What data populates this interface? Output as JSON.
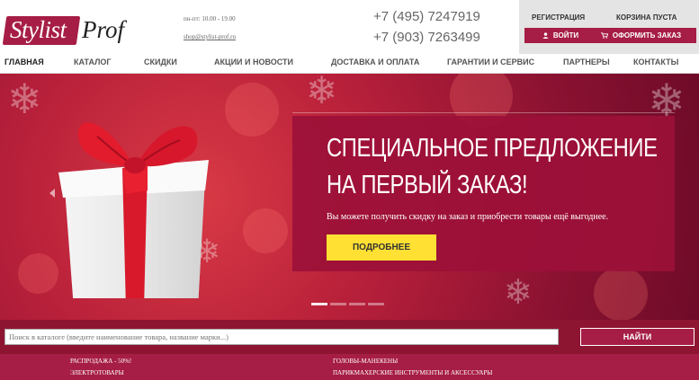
{
  "header": {
    "logo_part1": "Stylist",
    "logo_part2": "Prof",
    "hours": "пн-пт: 10.00 - 19.00",
    "email": "shop@stylist-prof.ru",
    "phone1": "+7 (495) 7247919",
    "phone2": "+7 (903) 7263499"
  },
  "account": {
    "register_label": "РЕГИСТРАЦИЯ",
    "cart_label": "КОРЗИНА ПУСТА",
    "login_button": "ВОЙТИ",
    "order_button": "ОФОРМИТЬ ЗАКАЗ"
  },
  "nav": {
    "items": [
      {
        "label": "Главная"
      },
      {
        "label": "Каталог"
      },
      {
        "label": "Скидки"
      },
      {
        "label": "Акции и новости"
      },
      {
        "label": "Доставка и оплата"
      },
      {
        "label": "Гарантии и сервис"
      },
      {
        "label": "Партнеры"
      },
      {
        "label": "Контакты"
      }
    ]
  },
  "banner": {
    "title_line1": "СПЕЦИАЛЬНОЕ ПРЕДЛОЖЕНИЕ",
    "title_line2": "НА ПЕРВЫЙ ЗАКАЗ!",
    "text": "Вы можете получить скидку на заказ и приобрести товары ещё выгоднее.",
    "button": "ПОДРОБНЕЕ",
    "active_slide": 1
  },
  "search": {
    "placeholder": "Поиск в каталоге (введите наименование товара, название марки...)",
    "button": "НАЙТИ"
  },
  "categories": {
    "col1": [
      "Распродажа - 50%!",
      "Электротовары"
    ],
    "col2": [
      "Головы-манекены",
      "Парикмахерские инструменты и аксессуары"
    ]
  },
  "colors": {
    "brand": "#a61d45",
    "promo_button": "#ffe033",
    "account_bg": "#e4e4e4"
  }
}
